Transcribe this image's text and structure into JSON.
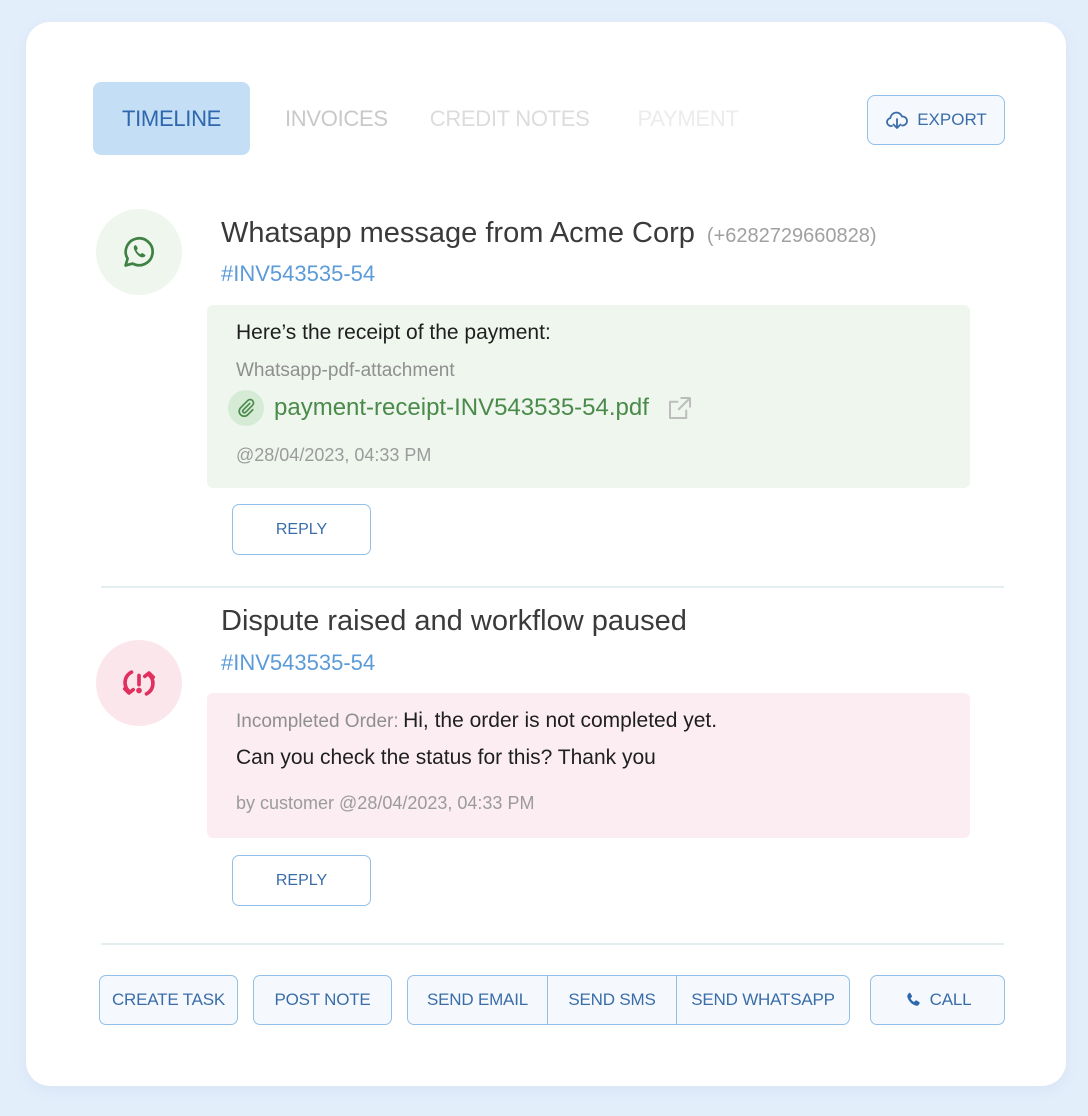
{
  "tabs": [
    {
      "label": "TIMELINE",
      "active": true
    },
    {
      "label": "INVOICES",
      "active": false
    },
    {
      "label": "CREDIT NOTES",
      "active": false
    },
    {
      "label": "PAYMENT",
      "active": false
    }
  ],
  "export_button": {
    "label": "EXPORT",
    "icon": "cloud-download-icon"
  },
  "timeline": [
    {
      "icon": "whatsapp-icon",
      "title": "Whatsapp message from Acme Corp",
      "phone": "(+6282729660828)",
      "invoice": "#INV543535-54",
      "message": "Here’s the receipt of the payment:",
      "attachment_label": "Whatsapp-pdf-attachment",
      "attachment_file": "payment-receipt-INV543535-54.pdf",
      "timestamp": "@28/04/2023, 04:33 PM",
      "reply_label": "REPLY"
    },
    {
      "icon": "dispute-sync-alert-icon",
      "title": "Dispute raised and workflow paused",
      "invoice": "#INV543535-54",
      "message_prefix": "Incompleted Order:",
      "message_line1": "Hi, the order is not completed yet.",
      "message_line2": "Can you check the status for this? Thank you",
      "byline": "by customer @28/04/2023, 04:33 PM",
      "reply_label": "REPLY"
    }
  ],
  "actions": {
    "create_task": "CREATE TASK",
    "post_note": "POST NOTE",
    "send_email": "SEND EMAIL",
    "send_sms": "SEND SMS",
    "send_whatsapp": "SEND WHATSAPP",
    "call": "CALL"
  },
  "colors": {
    "accent": "#3a6da8",
    "tab_active_bg": "#c4def6",
    "link": "#5b9bd8",
    "whatsapp_green": "#4a8a4a",
    "dispute_red": "#e0305f"
  }
}
